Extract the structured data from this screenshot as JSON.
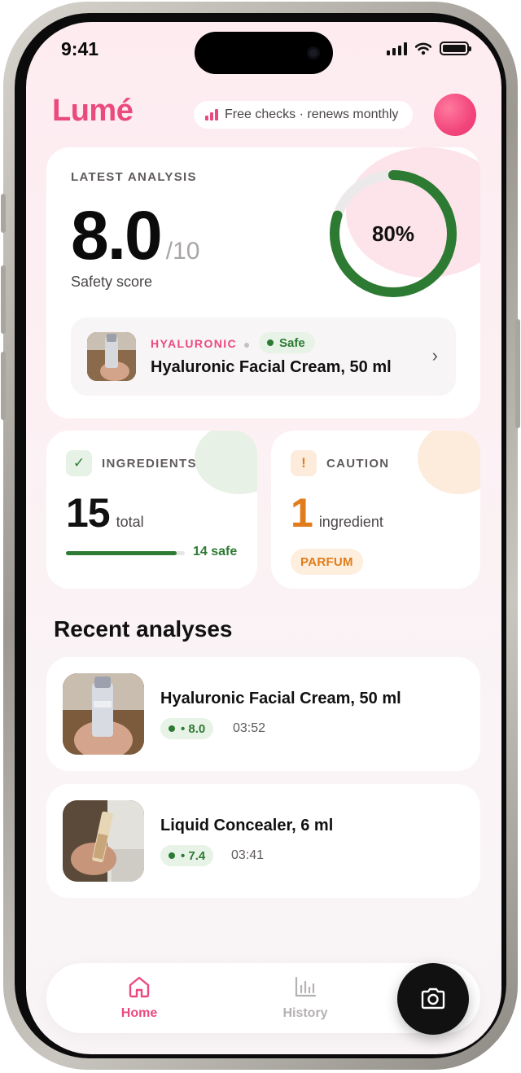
{
  "status_bar": {
    "time": "9:41"
  },
  "header": {
    "brand": "Lumé",
    "plan_chip": "Free checks · renews monthly"
  },
  "latest_analysis": {
    "label": "LATEST ANALYSIS",
    "score": "8.0",
    "score_max": "/10",
    "score_caption": "Safety score",
    "ring_percent_text": "80%",
    "ring_fraction": 0.8,
    "product": {
      "category": "HYALURONIC",
      "status": "Safe",
      "name": "Hyaluronic Facial Cream, 50 ml",
      "chevron": "›"
    }
  },
  "ingredients_card": {
    "icon": "check-icon",
    "icon_glyph": "✓",
    "label": "INGREDIENTS",
    "count": "15",
    "unit": "total",
    "safe_label": "14 safe",
    "safe_fraction": 0.933
  },
  "caution_card": {
    "icon": "exclamation-icon",
    "icon_glyph": "!",
    "label": "CAUTION",
    "count": "1",
    "unit": "ingredient",
    "tag": "PARFUM"
  },
  "recent": {
    "title": "Recent analyses",
    "items": [
      {
        "name": "Hyaluronic Facial Cream, 50 ml",
        "score": "• 8.0",
        "time": "03:52"
      },
      {
        "name": "Liquid Concealer, 6 ml",
        "score": "• 7.4",
        "time": "03:41"
      }
    ]
  },
  "nav": {
    "home": "Home",
    "history": "History",
    "camera_icon": "camera-icon"
  },
  "colors": {
    "brand": "#ea4a7e",
    "safe": "#2d7a33",
    "caution": "#e07c1c"
  }
}
